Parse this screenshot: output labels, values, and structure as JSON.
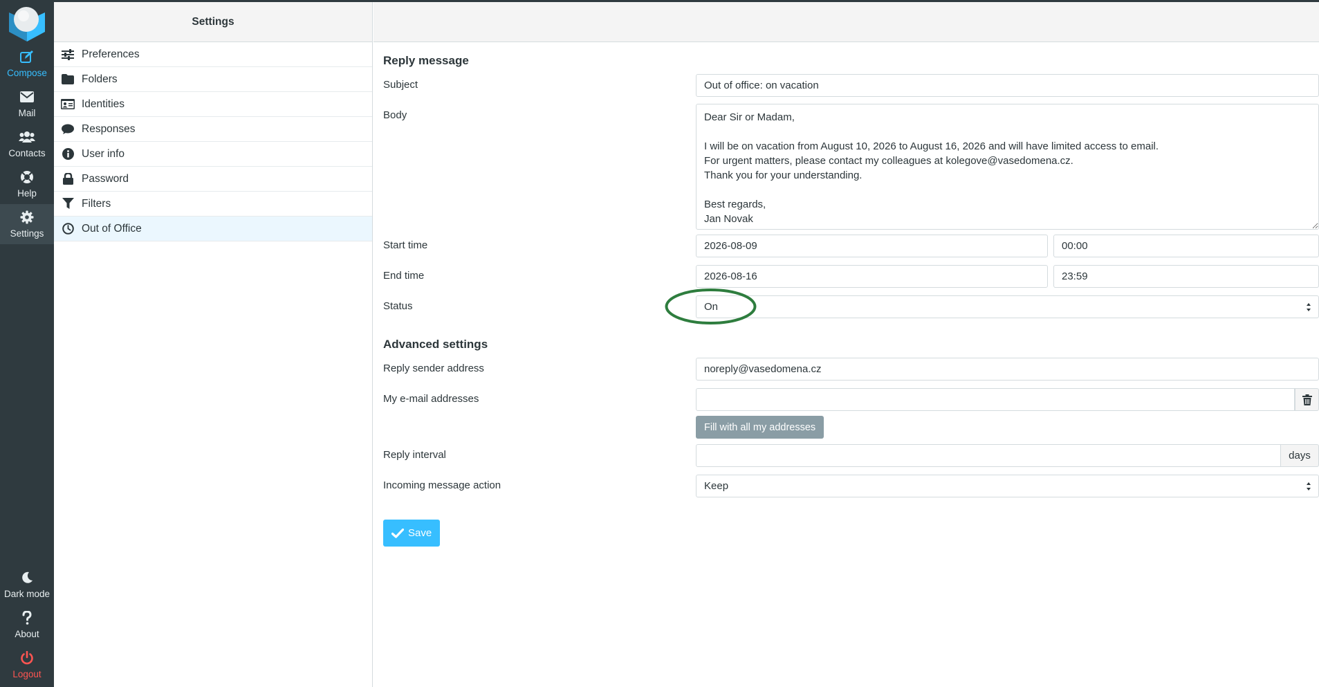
{
  "rail": {
    "compose": "Compose",
    "mail": "Mail",
    "contacts": "Contacts",
    "help": "Help",
    "settings": "Settings",
    "dark_mode": "Dark mode",
    "about": "About",
    "logout": "Logout"
  },
  "settings_panel": {
    "title": "Settings",
    "items": [
      {
        "label": "Preferences",
        "icon": "sliders-icon"
      },
      {
        "label": "Folders",
        "icon": "folder-icon"
      },
      {
        "label": "Identities",
        "icon": "id-card-icon"
      },
      {
        "label": "Responses",
        "icon": "speech-bubble-icon"
      },
      {
        "label": "User info",
        "icon": "info-icon"
      },
      {
        "label": "Password",
        "icon": "lock-icon"
      },
      {
        "label": "Filters",
        "icon": "filter-icon"
      },
      {
        "label": "Out of Office",
        "icon": "clock-icon",
        "selected": true
      }
    ]
  },
  "form": {
    "reply_section": "Reply message",
    "subject_label": "Subject",
    "subject_value": "Out of office: on vacation",
    "body_label": "Body",
    "body_value": "Dear Sir or Madam,\n\nI will be on vacation from August 10, 2026 to August 16, 2026 and will have limited access to email.\nFor urgent matters, please contact my colleagues at kolegove@vasedomena.cz.\nThank you for your understanding.\n\nBest regards,\nJan Novak",
    "start_label": "Start time",
    "start_date": "2026-08-09",
    "start_time": "00:00",
    "end_label": "End time",
    "end_date": "2026-08-16",
    "end_time": "23:59",
    "status_label": "Status",
    "status_value": "On",
    "advanced_section": "Advanced settings",
    "sender_label": "Reply sender address",
    "sender_value": "noreply@vasedomena.cz",
    "my_emails_label": "My e-mail addresses",
    "my_emails_value": "",
    "fill_button": "Fill with all my addresses",
    "interval_label": "Reply interval",
    "interval_value": "",
    "interval_unit": "days",
    "action_label": "Incoming message action",
    "action_value": "Keep",
    "save_button": "Save"
  },
  "colors": {
    "accent": "#37beff",
    "rail_bg": "#2f3a3f",
    "logout": "#ff5552",
    "highlight_ellipse": "#2e7d3e"
  }
}
